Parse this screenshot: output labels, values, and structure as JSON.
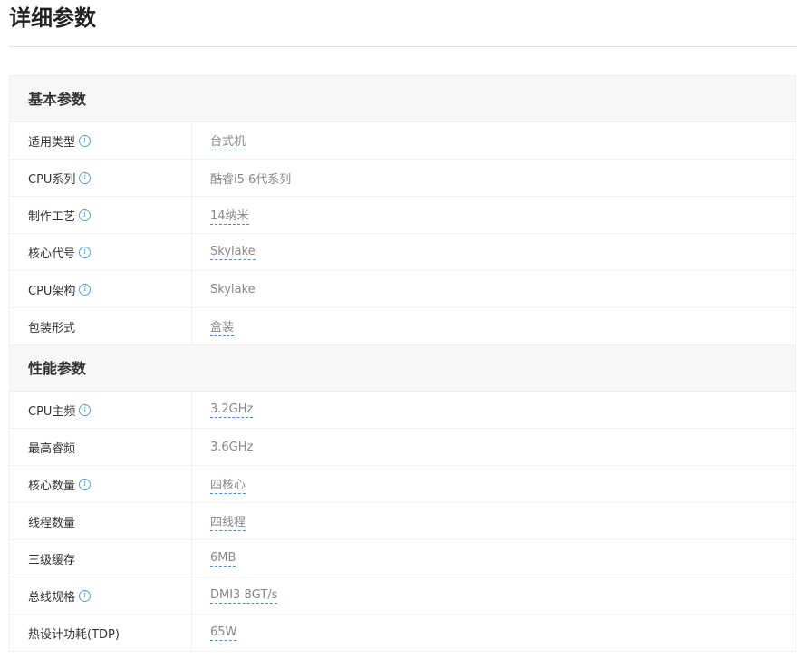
{
  "page": {
    "title": "详细参数"
  },
  "sections": [
    {
      "title": "基本参数",
      "rows": [
        {
          "label": "适用类型",
          "info": true,
          "value": "台式机",
          "link": true
        },
        {
          "label": "CPU系列",
          "info": true,
          "value": "酷睿i5 6代系列",
          "link": false
        },
        {
          "label": "制作工艺",
          "info": true,
          "value": "14纳米",
          "link": true
        },
        {
          "label": "核心代号",
          "info": true,
          "value": "Skylake",
          "link": true
        },
        {
          "label": "CPU架构",
          "info": true,
          "value": "Skylake",
          "link": false
        },
        {
          "label": "包装形式",
          "info": false,
          "value": "盒装",
          "link": true
        }
      ]
    },
    {
      "title": "性能参数",
      "rows": [
        {
          "label": "CPU主频",
          "info": true,
          "value": "3.2GHz",
          "link": true
        },
        {
          "label": "最高睿频",
          "info": false,
          "value": "3.6GHz",
          "link": false
        },
        {
          "label": "核心数量",
          "info": true,
          "value": "四核心",
          "link": true
        },
        {
          "label": "线程数量",
          "info": false,
          "value": "四线程",
          "link": true
        },
        {
          "label": "三级缓存",
          "info": false,
          "value": "6MB",
          "link": true
        },
        {
          "label": "总线规格",
          "info": true,
          "value": "DMI3 8GT/s",
          "link": true
        },
        {
          "label": "热设计功耗(TDP)",
          "info": false,
          "value": "65W",
          "link": true
        }
      ]
    }
  ],
  "icons": {
    "info": "info-icon"
  },
  "colors": {
    "info_icon": "#5aa0dc",
    "link_underline": "#3d8fd8",
    "section_bg": "#f7f7f7"
  }
}
